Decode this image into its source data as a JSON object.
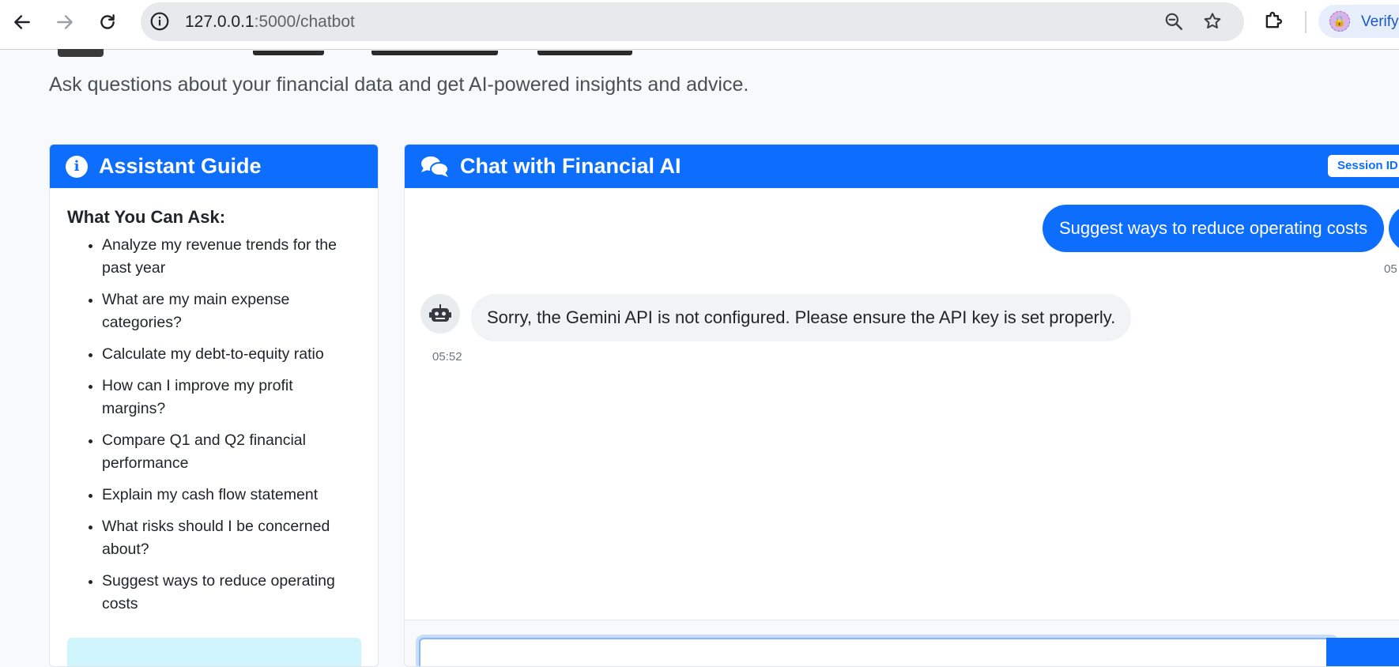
{
  "browser": {
    "url_host": "127.0.0.1",
    "url_path": ":5000/chatbot",
    "profile_label": "Verify"
  },
  "page": {
    "subtitle": "Ask questions about your financial data and get AI-powered insights and advice."
  },
  "guide": {
    "title": "Assistant Guide",
    "subtitle": "What You Can Ask:",
    "items": [
      "Analyze my revenue trends for the past year",
      "What are my main expense categories?",
      "Calculate my debt-to-equity ratio",
      "How can I improve my profit margins?",
      "Compare Q1 and Q2 financial performance",
      "Explain my cash flow statement",
      "What risks should I be concerned about?",
      "Suggest ways to reduce operating costs"
    ]
  },
  "chat": {
    "title": "Chat with Financial AI",
    "session_label": "Session ID",
    "messages": [
      {
        "role": "user",
        "text": "Suggest ways to reduce operating costs",
        "time": "05"
      },
      {
        "role": "bot",
        "text": "Sorry, the Gemini API is not configured. Please ensure the API key is set properly.",
        "time": "05:52"
      }
    ],
    "input_placeholder": ""
  },
  "colors": {
    "primary": "#0d6efd",
    "page_bg": "#f8f9fa",
    "bot_bubble": "#f1f3f5"
  },
  "icons": {
    "back": "arrow-left-icon",
    "forward": "arrow-right-icon",
    "reload": "reload-icon",
    "site_info": "info-icon",
    "zoom": "zoom-out-icon",
    "bookmark": "star-icon",
    "extensions": "puzzle-icon",
    "guide": "info-circle-icon",
    "chat": "comments-icon",
    "bot": "robot-icon"
  }
}
